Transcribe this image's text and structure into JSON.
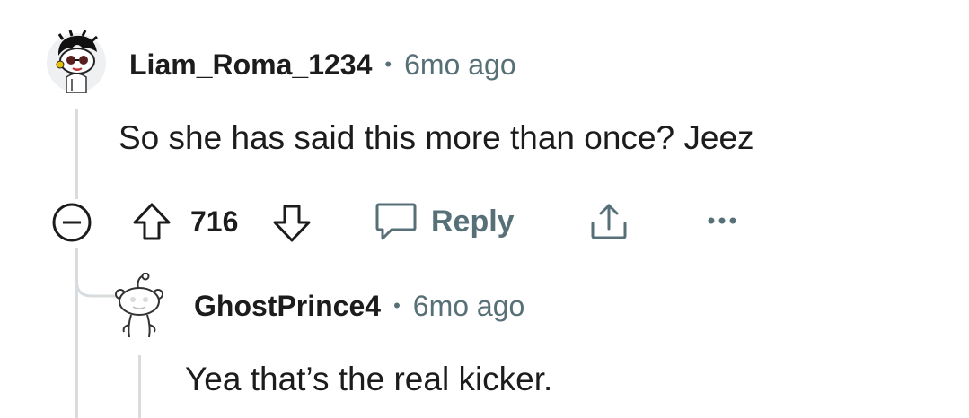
{
  "comments": [
    {
      "username": "Liam_Roma_1234",
      "separator": "•",
      "time": "6mo ago",
      "body": "So she has said this more than once? Jeez",
      "score": "716",
      "reply_label": "Reply",
      "avatar": "snoo-avatar-headphones"
    },
    {
      "username": "GhostPrince4",
      "separator": "•",
      "time": "6mo ago",
      "body": "Yea that’s the real kicker.",
      "avatar": "default-snoo-avatar"
    }
  ],
  "icons": {
    "collapse": "collapse-thread-icon",
    "upvote": "upvote-arrow-icon",
    "downvote": "downvote-arrow-icon",
    "reply": "speech-bubble-icon",
    "share": "share-icon",
    "more": "more-options-icon"
  },
  "colors": {
    "text": "#1c1c1c",
    "meta": "#576f76",
    "thread_line": "#d9dcde"
  }
}
